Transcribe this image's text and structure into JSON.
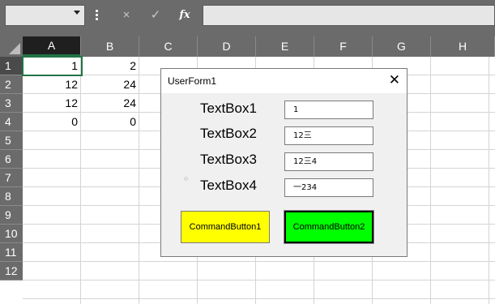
{
  "formula_bar": {
    "cancel_icon": "×",
    "enter_icon": "✓",
    "fx_label": "fx",
    "value": ""
  },
  "sheet": {
    "columns": [
      "A",
      "B",
      "C",
      "D",
      "E",
      "F",
      "G",
      "H"
    ],
    "rows": [
      "1",
      "2",
      "3",
      "4",
      "5",
      "6",
      "7",
      "8",
      "9",
      "10",
      "11",
      "12"
    ],
    "selected_cell": "A1",
    "cells": {
      "A1": "1",
      "B1": "2",
      "A2": "12",
      "B2": "24",
      "A3": "12",
      "B3": "24",
      "A4": "0",
      "B4": "0"
    }
  },
  "userform": {
    "title": "UserForm1",
    "close_icon": "✕",
    "labels": [
      "TextBox1",
      "TextBox2",
      "TextBox3",
      "TextBox4"
    ],
    "textboxes": [
      "1",
      "12三",
      "12三4",
      "一234"
    ],
    "buttons": [
      {
        "label": "CommandButton1",
        "color": "#ffff00"
      },
      {
        "label": "CommandButton2",
        "color": "#00ff00"
      }
    ]
  },
  "colors": {
    "header_bg": "#6b6b6b",
    "selection_green": "#217346"
  }
}
